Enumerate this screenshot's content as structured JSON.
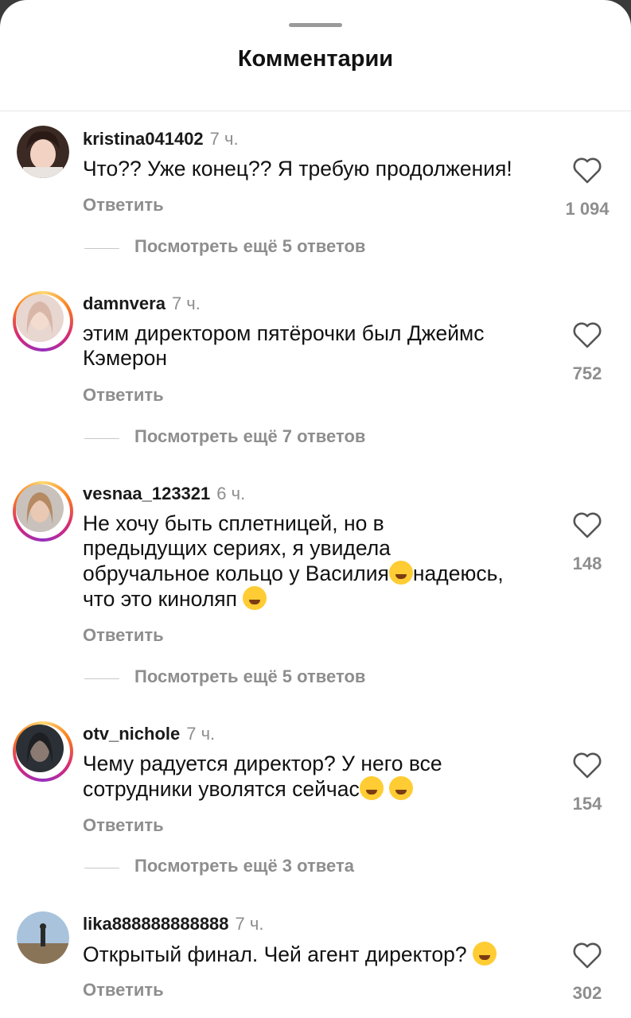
{
  "header": {
    "title": "Комментарии"
  },
  "reply_label": "Ответить",
  "comments": [
    {
      "username": "kristina041402",
      "time": "7 ч.",
      "text": "Что?? Уже конец?? Я требую продолжения!",
      "likes": "1 094",
      "more_replies": "Посмотреть ещё 5 ответов",
      "story_ring": false
    },
    {
      "username": "damnvera",
      "time": "7 ч.",
      "text_lines": [
        "этим директором пятёрочки был Джеймс",
        "Кэмерон"
      ],
      "likes": "752",
      "more_replies": "Посмотреть ещё 7 ответов",
      "story_ring": true
    },
    {
      "username": "vesnaa_123321",
      "time": "6 ч.",
      "text_lines": [
        "Не хочу быть сплетницей, но в",
        "предыдущих сериях, я увидела",
        "обручальное кольцо у Василия",
        "надеюсь,",
        "что это киноляп"
      ],
      "emojis": [
        "smirking-face",
        "grinning-face"
      ],
      "likes": "148",
      "more_replies": "Посмотреть ещё 5 ответов",
      "story_ring": true
    },
    {
      "username": "otv_nichole",
      "time": "7 ч.",
      "text_lines": [
        "Чему радуется директор? У него все",
        "сотрудники уволятся сейчас"
      ],
      "emojis": [
        "rofl-face",
        "rofl-face"
      ],
      "likes": "154",
      "more_replies": "Посмотреть ещё 3 ответа",
      "story_ring": true
    },
    {
      "username": "lika888888888888",
      "time": "7 ч.",
      "text": "Открытый финал. Чей агент директор?",
      "emojis": [
        "tears-of-joy-face"
      ],
      "likes": "302",
      "story_ring": false
    }
  ],
  "colors": {
    "secondary_text": "#8e8e8e",
    "primary_text": "#111111",
    "background": "#ffffff"
  }
}
